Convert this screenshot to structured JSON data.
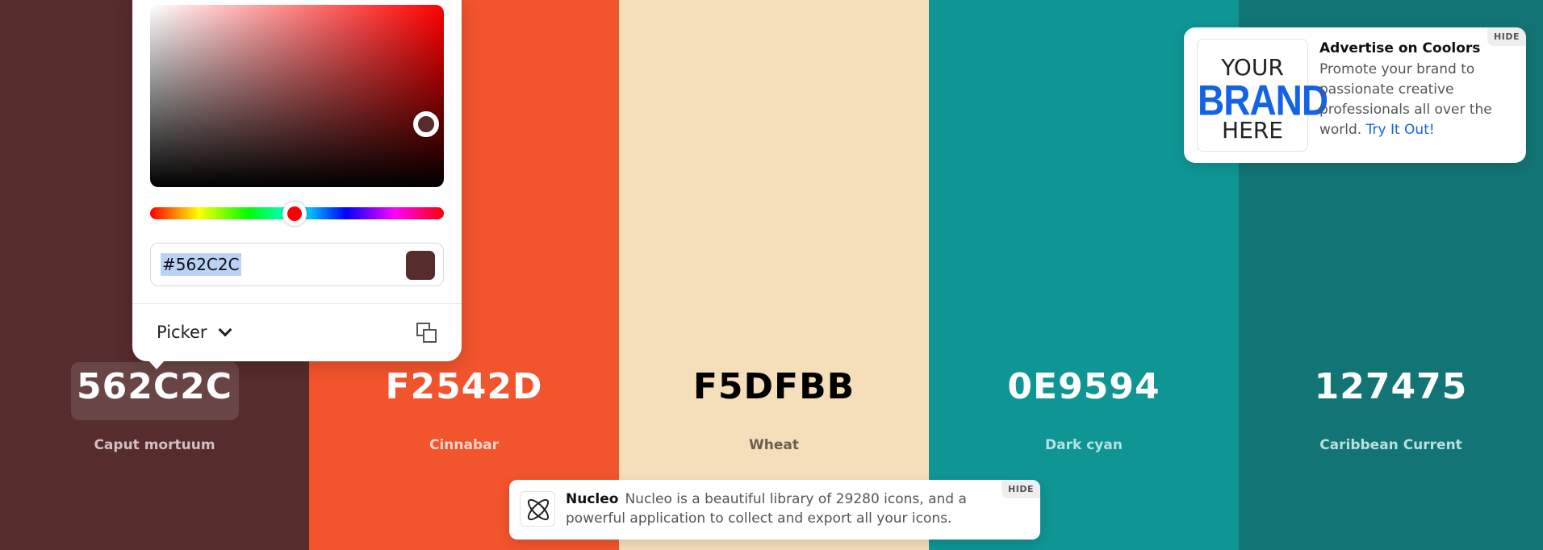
{
  "colors": [
    {
      "hex": "562C2C",
      "name": "Caput mortuum",
      "bg": "#562C2C",
      "fg": "#ffffff",
      "sub": "#d2c0c0",
      "width": 383
    },
    {
      "hex": "F2542D",
      "name": "Cinnabar",
      "bg": "#F2542D",
      "fg": "#ffffff",
      "sub": "#ffd7cc",
      "width": 384
    },
    {
      "hex": "F5DFBB",
      "name": "Wheat",
      "bg": "#F5DFBB",
      "fg": "#000000",
      "sub": "#6a6050",
      "width": 384
    },
    {
      "hex": "0E9594",
      "name": "Dark cyan",
      "bg": "#0E9594",
      "fg": "#ffffff",
      "sub": "#b8e2e1",
      "width": 384
    },
    {
      "hex": "127475",
      "name": "Caribbean Current",
      "bg": "#127475",
      "fg": "#ffffff",
      "sub": "#bcdede",
      "width": 377
    }
  ],
  "picker": {
    "hex_value": "#562C2C",
    "mode_label": "Picker",
    "swatch_color": "#562C2C"
  },
  "ad": {
    "logo_line1": "YOUR",
    "logo_line2": "BRAND",
    "logo_line3": "HERE",
    "title": "Advertise on Coolors",
    "body": "Promote your brand to passionate creative professionals all over the world.",
    "link": "Try It Out!",
    "hide_label": "HIDE"
  },
  "notification": {
    "brand": "Nucleo",
    "text": "Nucleo is a beautiful library of 29280 icons, and a powerful application to collect and export all your icons.",
    "hide_label": "HIDE"
  }
}
